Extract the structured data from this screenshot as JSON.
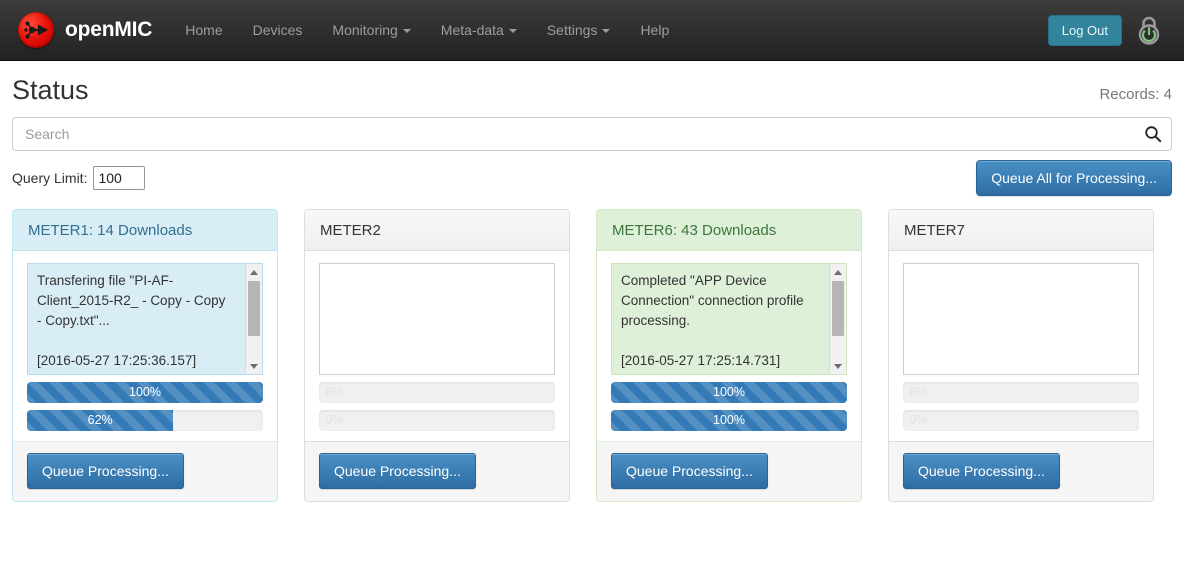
{
  "navbar": {
    "brand": "openMIC",
    "brand_icon": "openmic-logo-icon",
    "links": [
      {
        "label": "Home",
        "caret": false
      },
      {
        "label": "Devices",
        "caret": false
      },
      {
        "label": "Monitoring",
        "caret": true
      },
      {
        "label": "Meta-data",
        "caret": true
      },
      {
        "label": "Settings",
        "caret": true
      },
      {
        "label": "Help",
        "caret": false
      }
    ],
    "logout_label": "Log Out",
    "lock_icon": "lock-power-icon",
    "background_color": "#2d2d2d",
    "logout_color": "#31849b",
    "lock_color": "#8cc98c"
  },
  "header": {
    "title": "Status",
    "records_label": "Records: 4"
  },
  "search": {
    "placeholder": "Search",
    "value": "",
    "icon": "search-icon"
  },
  "query": {
    "label": "Query Limit:",
    "value": "100",
    "queue_all_label": "Queue All for Processing..."
  },
  "cards": [
    {
      "title": "METER1: 14 Downloads",
      "state": "info",
      "log": "Transfering file \"PI-AF-Client_2015-R2_ - Copy - Copy - Copy.txt\"...\n\n[2016-05-27 17:25:36.157]",
      "has_scrollbar": true,
      "progress": [
        {
          "label": "100%",
          "value": 100
        },
        {
          "label": "62%",
          "value": 62
        }
      ],
      "button_label": "Queue Processing..."
    },
    {
      "title": "METER2",
      "state": "default",
      "log": "",
      "has_scrollbar": false,
      "progress": [
        {
          "label": "0%",
          "value": 0
        },
        {
          "label": "0%",
          "value": 0
        }
      ],
      "button_label": "Queue Processing..."
    },
    {
      "title": "METER6: 43 Downloads",
      "state": "ok",
      "log": "Completed \"APP Device Connection\" connection profile processing.\n\n[2016-05-27 17:25:14.731]",
      "has_scrollbar": true,
      "progress": [
        {
          "label": "100%",
          "value": 100
        },
        {
          "label": "100%",
          "value": 100
        }
      ],
      "button_label": "Queue Processing..."
    },
    {
      "title": "METER7",
      "state": "default",
      "log": "",
      "has_scrollbar": false,
      "progress": [
        {
          "label": "0%",
          "value": 0
        },
        {
          "label": "0%",
          "value": 0
        }
      ],
      "button_label": "Queue Processing..."
    }
  ],
  "colors": {
    "info_bg": "#d9edf7",
    "info_text": "#31708f",
    "ok_bg": "#dff0d8",
    "ok_text": "#3c763d",
    "primary": "#2e6da4",
    "progress_fill": "#337ab7"
  }
}
